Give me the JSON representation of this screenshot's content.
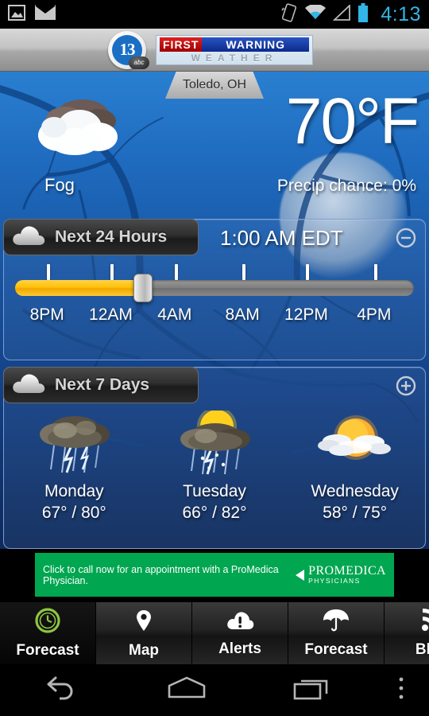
{
  "statusbar": {
    "left_icons": [
      "image-icon",
      "mail-icon"
    ],
    "right_icons": [
      "screen-rotation-icon",
      "wifi-icon",
      "cell-signal-icon",
      "battery-icon"
    ],
    "time": "4:13"
  },
  "appbar": {
    "station_number": "13",
    "station_network": "abc",
    "brand_first": "FIRST",
    "brand_warning": "WARNING",
    "brand_weather": "WEATHER"
  },
  "current": {
    "location": "Toledo, OH",
    "temperature": "70°F",
    "precip": "Precip chance: 0%",
    "condition": "Fog",
    "condition_icon": "fog-cloud-icon"
  },
  "hourly": {
    "title": "Next 24 Hours",
    "header_icon": "cloud-icon",
    "time": "1:00 AM EDT",
    "toggle_icon": "minus-circle-icon",
    "slider_value_pct": 32,
    "tick_labels": [
      "8PM",
      "12AM",
      "4AM",
      "8AM",
      "12PM",
      "4PM"
    ],
    "tick_positions_pct": [
      8,
      24,
      40,
      57,
      73,
      90
    ]
  },
  "daily": {
    "title": "Next 7 Days",
    "header_icon": "cloud-icon",
    "toggle_icon": "plus-circle-icon",
    "days": [
      {
        "name": "Monday",
        "temps": "67° / 80°",
        "icon": "thunderstorm-icon",
        "low": 67,
        "high": 80
      },
      {
        "name": "Tuesday",
        "temps": "66° / 82°",
        "icon": "sun-thunderstorm-icon",
        "low": 66,
        "high": 82
      },
      {
        "name": "Wednesday",
        "temps": "58° / 75°",
        "icon": "sun-clouds-icon",
        "low": 58,
        "high": 75
      }
    ]
  },
  "ad": {
    "text": "Click to call now for an appointment with a ProMedica Physician.",
    "brand_line1": "PROMEDICA",
    "brand_line2": "PHYSICIANS",
    "background_color": "#00a650"
  },
  "tabs": [
    {
      "label": "Forecast",
      "icon": "clock-icon",
      "active": true
    },
    {
      "label": "Map",
      "icon": "map-pin-icon",
      "active": false
    },
    {
      "label": "Alerts",
      "icon": "alert-cloud-icon",
      "active": false
    },
    {
      "label": "Forecast",
      "icon": "umbrella-icon",
      "active": false
    },
    {
      "label": "Blog",
      "icon": "rss-icon",
      "active": false
    }
  ],
  "navbar": {
    "back": "back-icon",
    "home": "home-icon",
    "recents": "recents-icon",
    "menu": "overflow-menu-icon"
  },
  "colors": {
    "accent_cyan": "#33b5e5",
    "slider_fill": "#ffc107",
    "ad_green": "#00a650",
    "active_tab_green": "#8dc63f"
  }
}
